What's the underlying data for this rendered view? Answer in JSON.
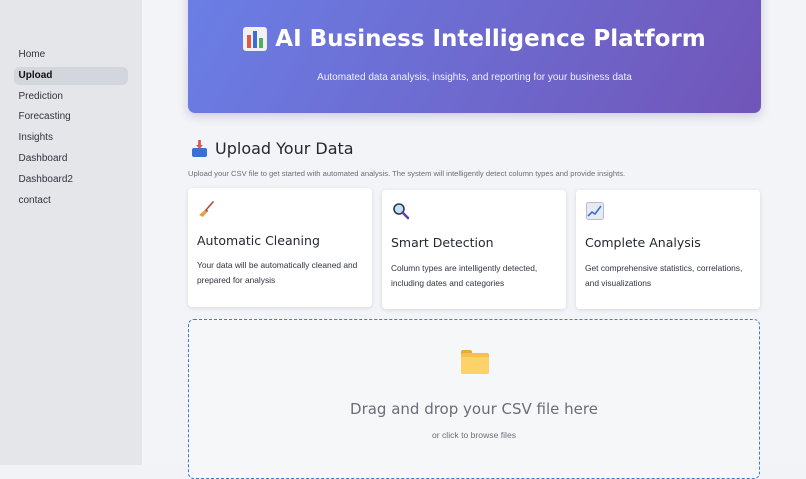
{
  "sidebar": {
    "items": [
      {
        "label": "Home"
      },
      {
        "label": "Upload"
      },
      {
        "label": "Prediction"
      },
      {
        "label": "Forecasting"
      },
      {
        "label": "Insights"
      },
      {
        "label": "Dashboard"
      },
      {
        "label": "Dashboard2"
      },
      {
        "label": "contact"
      }
    ],
    "active_item": "Upload"
  },
  "hero": {
    "icon": "bar-chart-icon",
    "title": "AI Business Intelligence Platform",
    "subtitle": "Automated data analysis, insights, and reporting for your business data",
    "gradient_start": "#6a7fe6",
    "gradient_end": "#7155b8"
  },
  "upload_section": {
    "icon": "inbox-tray-icon",
    "title": "Upload Your Data",
    "description": "Upload your CSV file to get started with automated analysis. The system will intelligently detect column types and provide insights."
  },
  "features": [
    {
      "icon": "broom-icon",
      "title": "Automatic Cleaning",
      "text": "Your data will be automatically cleaned and prepared for analysis"
    },
    {
      "icon": "magnifier-icon",
      "title": "Smart Detection",
      "text": "Column types are intelligently detected, including dates and categories"
    },
    {
      "icon": "trend-chart-icon",
      "title": "Complete Analysis",
      "text": "Get comprehensive statistics, correlations, and visualizations"
    }
  ],
  "dropzone": {
    "icon": "folder-icon",
    "title": "Drag and drop your CSV file here",
    "subtitle": "or click to browse files",
    "border_color": "#3a7bd5"
  }
}
